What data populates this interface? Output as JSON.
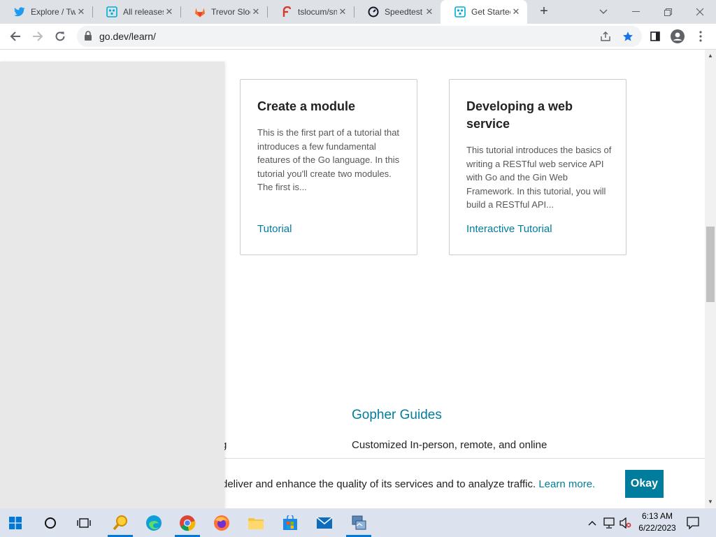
{
  "browser": {
    "tabs": [
      {
        "title": "Explore / Tw",
        "icon": "twitter-icon"
      },
      {
        "title": "All releases",
        "icon": "go-gopher-icon"
      },
      {
        "title": "Trevor Sloc",
        "icon": "gitlab-icon"
      },
      {
        "title": "tslocum/sn",
        "icon": "fossil-icon"
      },
      {
        "title": "Speedtest",
        "icon": "speedtest-icon"
      },
      {
        "title": "Get Started",
        "icon": "go-gopher-icon"
      }
    ],
    "active_tab_index": 5,
    "url": "go.dev/learn/"
  },
  "page": {
    "cards": [
      {
        "title": "Create a module",
        "description": "This is the first part of a tutorial that introduces a few fundamental features of the Go language. In this tutorial you'll create two modules. The first is...",
        "link": "Tutorial"
      },
      {
        "title": "Developing a web service",
        "description": "This tutorial introduces the basics of writing a RESTful web service API with Go and the Gin Web Framework. In this tutorial, you will build a RESTful API...",
        "link": "Interactive Tutorial"
      }
    ],
    "guides": {
      "heading": "Gopher Guides",
      "text": "Customized In-person, remote, and online",
      "left_fragment": "g"
    },
    "cookie": {
      "text": "deliver and enhance the quality of its services and to analyze traffic.",
      "link": "Learn more.",
      "button": "Okay"
    }
  },
  "scrollbar": {
    "position_fraction": 0.46
  },
  "taskbar": {
    "apps": [
      "start-icon",
      "cortana-icon",
      "task-view-icon",
      "search-app-icon",
      "edge-icon",
      "chrome-icon",
      "firefox-icon",
      "file-explorer-icon",
      "store-icon",
      "mail-icon",
      "network-app-icon"
    ],
    "time": "6:13 AM",
    "date": "6/22/2023"
  },
  "colors": {
    "accent": "#007d9c",
    "chrome_tab_strip": "#dee1e6",
    "taskbar": "#dde3ee"
  }
}
